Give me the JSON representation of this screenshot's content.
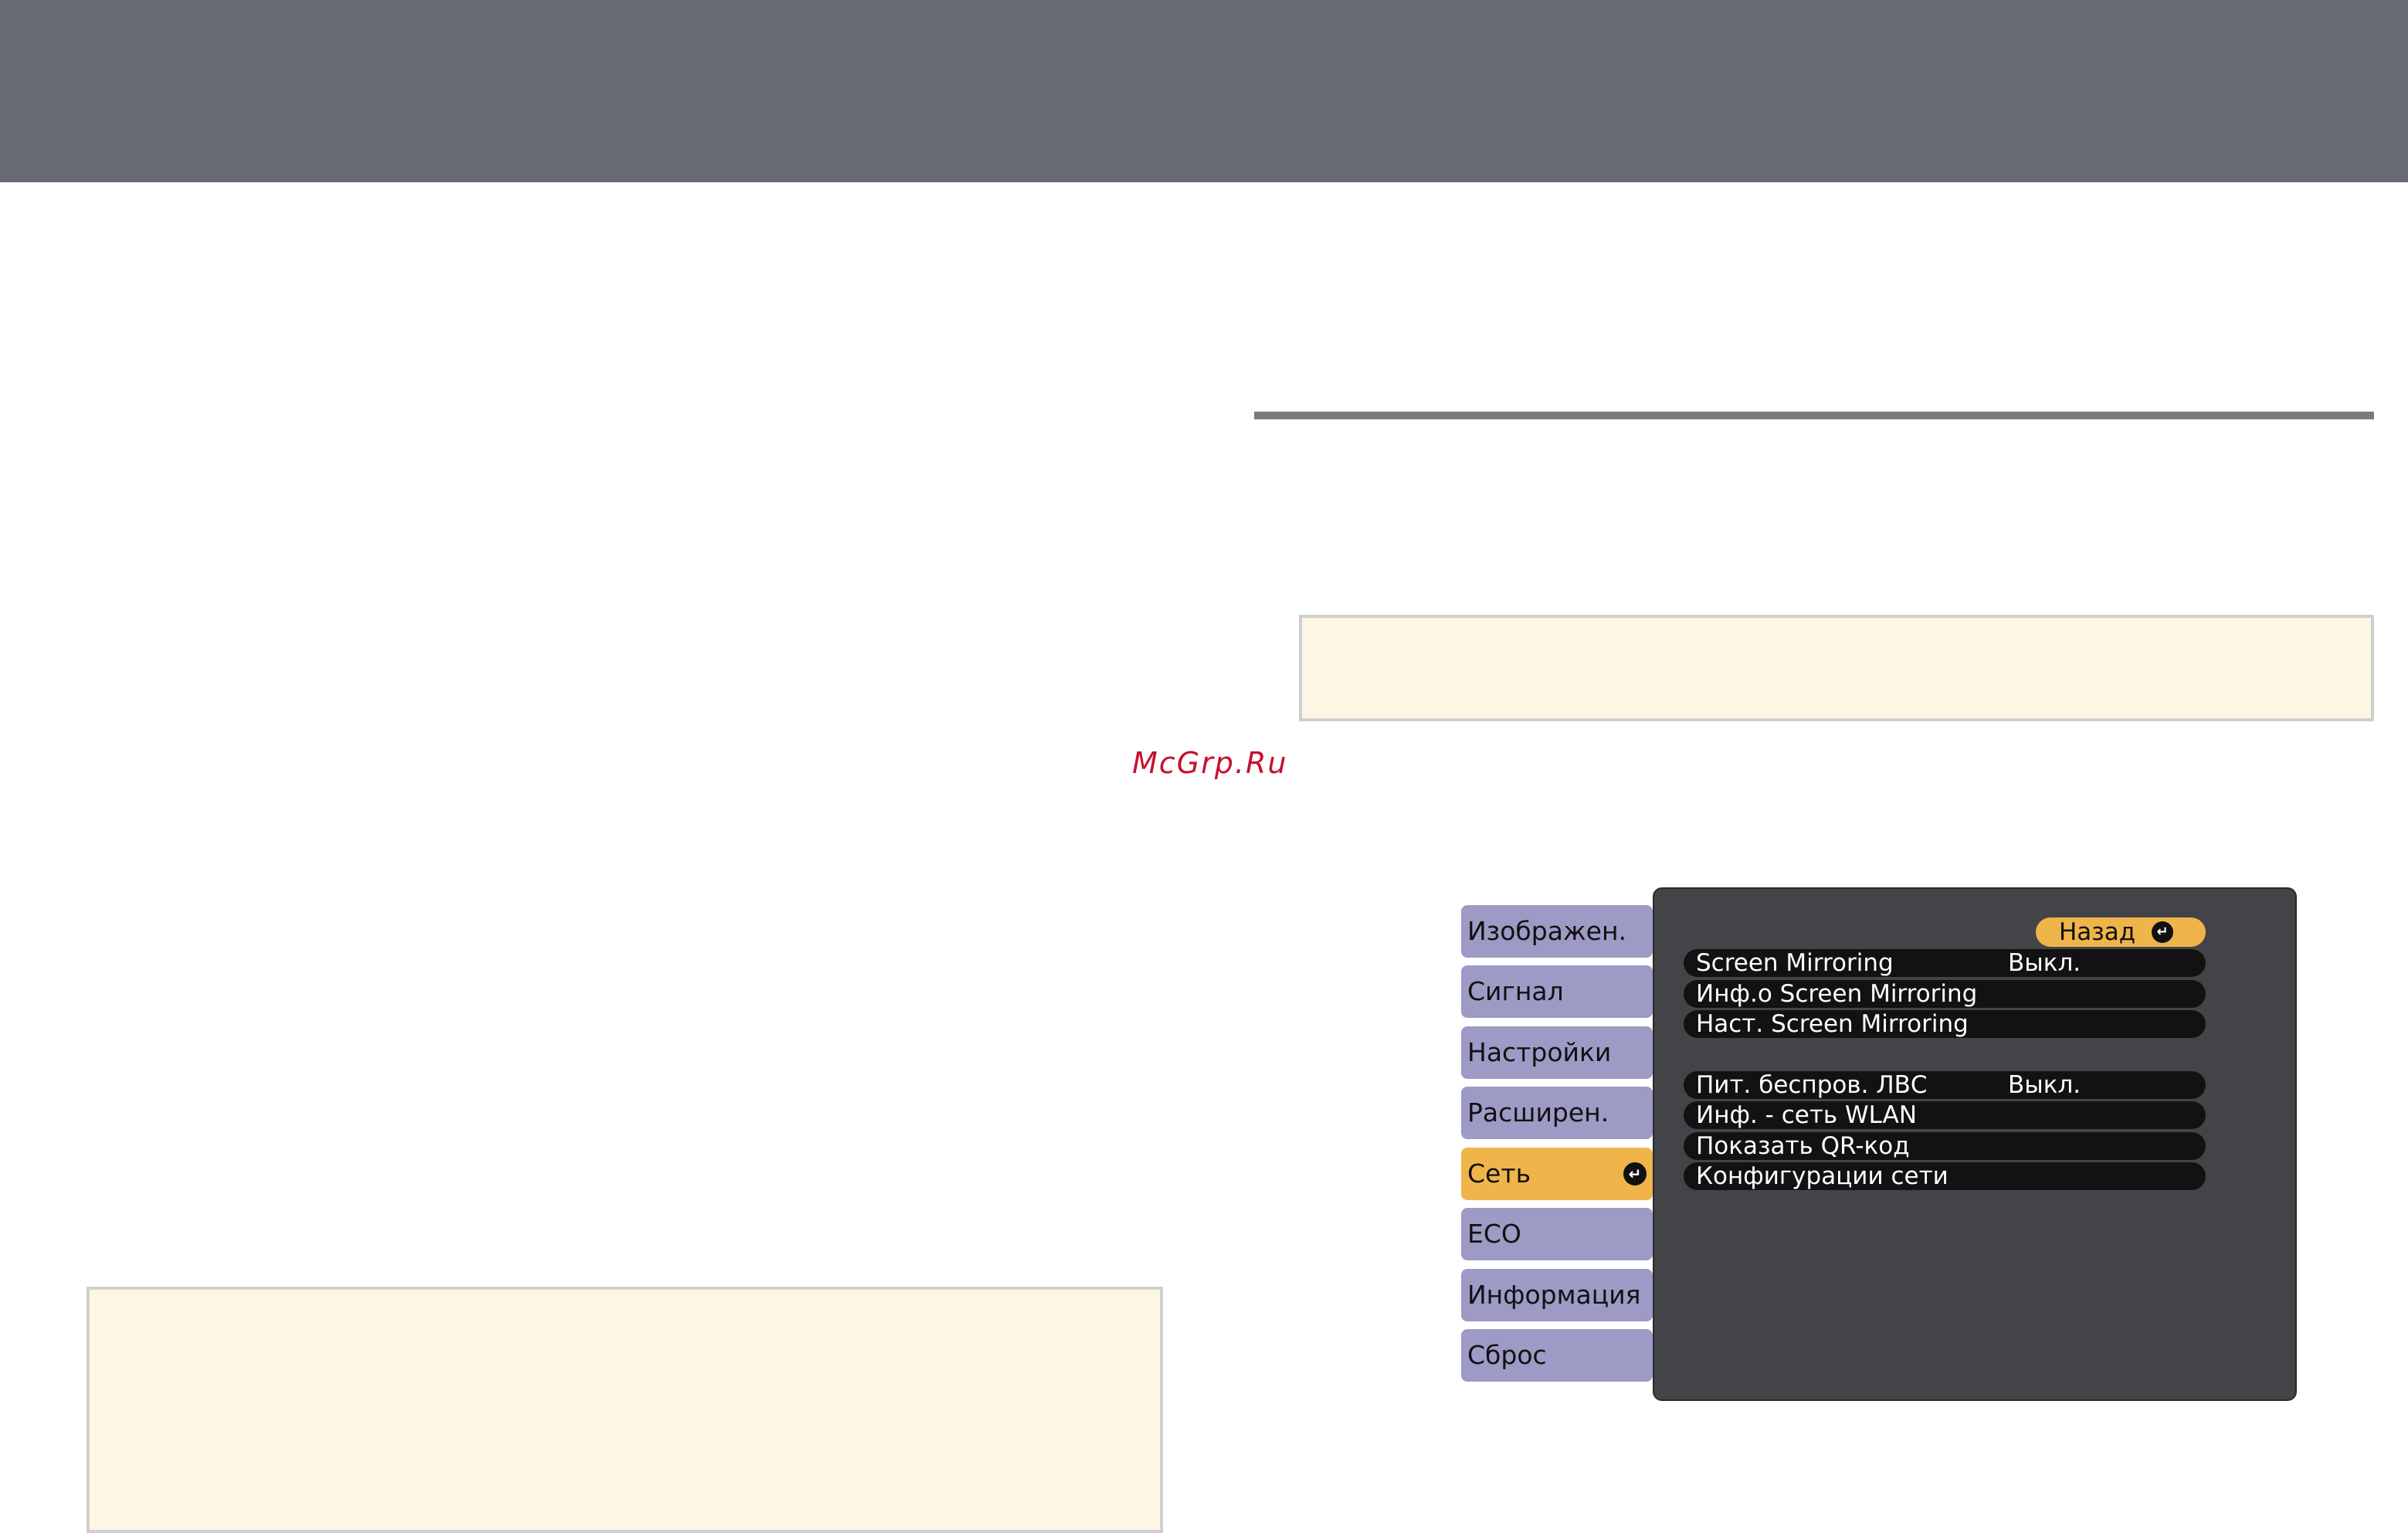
{
  "watermark": "McGrp.Ru",
  "menu": {
    "tabs": [
      {
        "label": "Изображен."
      },
      {
        "label": "Сигнал"
      },
      {
        "label": "Настройки"
      },
      {
        "label": "Расширен."
      },
      {
        "label": "Сеть",
        "selected": true
      },
      {
        "label": "ECO"
      },
      {
        "label": "Информация"
      },
      {
        "label": "Сброс"
      }
    ],
    "back_label": "Назад",
    "rows": [
      {
        "label": "Screen Mirroring",
        "value": "Выкл."
      },
      {
        "label": "Инф.о Screen Mirroring",
        "value": ""
      },
      {
        "label": "Наст. Screen Mirroring",
        "value": ""
      },
      {
        "label": "Пит. беспров. ЛВС",
        "value": "Выкл."
      },
      {
        "label": "Инф. - сеть WLAN",
        "value": ""
      },
      {
        "label": "Показать QR-код",
        "value": ""
      },
      {
        "label": "Конфигурации сети",
        "value": ""
      }
    ],
    "enter_icon": "enter-return-icon"
  },
  "colors": {
    "banner": "#676a73",
    "note_background": "#fdf6e5",
    "tab": "#9e9ac6",
    "tab_selected": "#efb54a",
    "panel": "#434447",
    "watermark": "#c8102e"
  }
}
